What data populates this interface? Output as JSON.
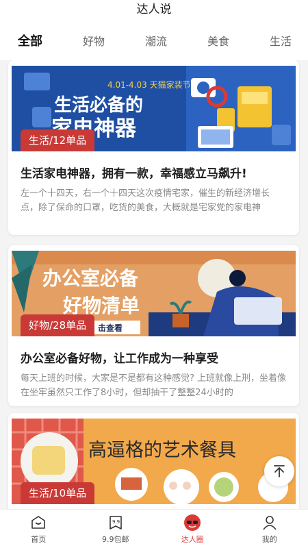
{
  "header": {
    "title": "达人说"
  },
  "tabs": [
    {
      "label": "全部",
      "active": true
    },
    {
      "label": "好物"
    },
    {
      "label": "潮流"
    },
    {
      "label": "美食"
    },
    {
      "label": "生活"
    }
  ],
  "cards": [
    {
      "banner": {
        "date": "4.01-4.03 天猫家装节",
        "line1": "生活必备的",
        "line2": "家电神器"
      },
      "badge": "生活/12单品",
      "title": "生活家电神器，拥有一款，幸福感立马飙升!",
      "desc": "左一个十四天，右一个十四天这次疫情宅家，催生的新经济增长点，除了保命的口罩，吃货的美食，大概就是宅家党的家电神"
    },
    {
      "banner": {
        "line1": "办公室必备",
        "line2": "好物清单",
        "cta": "击查看"
      },
      "badge": "好物/28单品",
      "title": "办公室必备好物，让工作成为一种享受",
      "desc": "每天上班的时候，大家是不是都有这种感觉? 上班就像上刑，坐着像在坐牢虽然只工作了8小时，但却抽干了整整24小时的"
    },
    {
      "banner": {
        "line1": "高逼格的艺术餐具"
      },
      "badge": "生活/10单品"
    }
  ],
  "bottom_nav": [
    {
      "label": "首页",
      "icon": "home-icon"
    },
    {
      "label": "9.9包邮",
      "icon": "coupon-icon"
    },
    {
      "label": "达人圈",
      "icon": "expert-avatar-icon",
      "active": true
    },
    {
      "label": "我的",
      "icon": "user-icon"
    }
  ],
  "colors": {
    "accent": "#d93a36",
    "badge": "#c93a37"
  }
}
